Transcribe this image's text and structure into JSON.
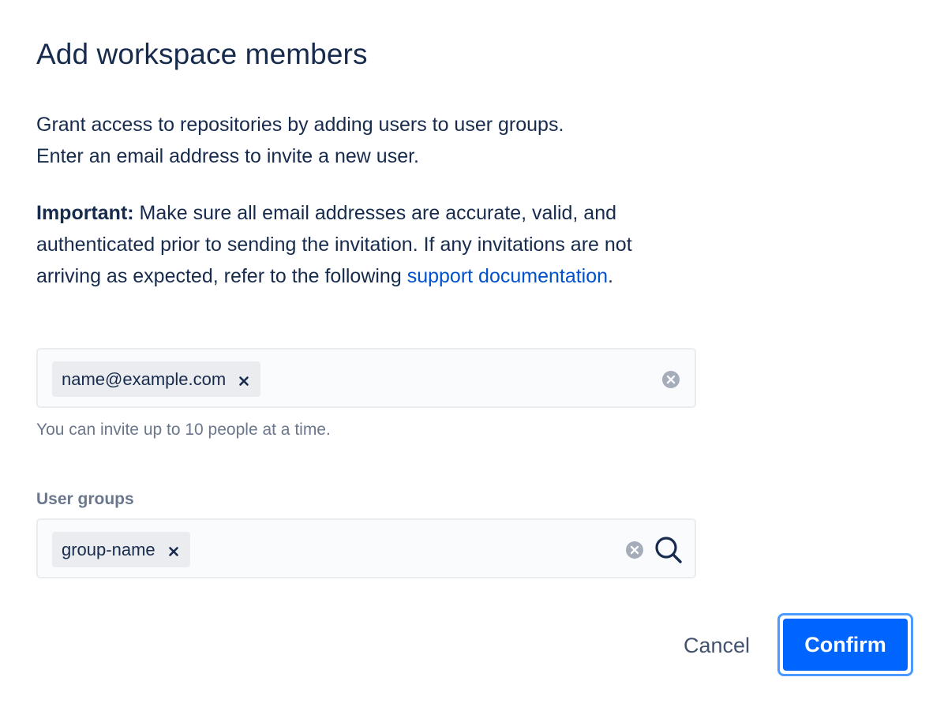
{
  "dialog": {
    "title": "Add workspace members",
    "intro_line1": "Grant access to repositories by adding users to user groups.",
    "intro_line2": "Enter an email address to invite a new user.",
    "important_label": "Important:",
    "important_text": " Make sure all email addresses are accurate, valid, and authenticated prior to sending the invitation. If any invitations are not arriving as expected, refer to the following ",
    "support_link": "support documentation",
    "important_end": "."
  },
  "email_field": {
    "tag": "name@example.com",
    "tag_remove_icon": "close-icon",
    "clear_icon": "clear-circle-icon",
    "helper_text": "You can invite up to 10 people at a time."
  },
  "groups_field": {
    "label": "User groups",
    "tag": "group-name",
    "tag_remove_icon": "close-icon",
    "clear_icon": "clear-circle-icon",
    "search_icon": "search-icon"
  },
  "actions": {
    "cancel_label": "Cancel",
    "confirm_label": "Confirm"
  },
  "colors": {
    "primary": "#0065ff",
    "focus_ring": "#4c9aff",
    "link": "#0052cc",
    "text": "#172b4d",
    "subtle_text": "#6b778c",
    "field_bg": "#fafbfc",
    "tag_bg": "#ebecf0",
    "clear_icon": "#a5adba"
  }
}
